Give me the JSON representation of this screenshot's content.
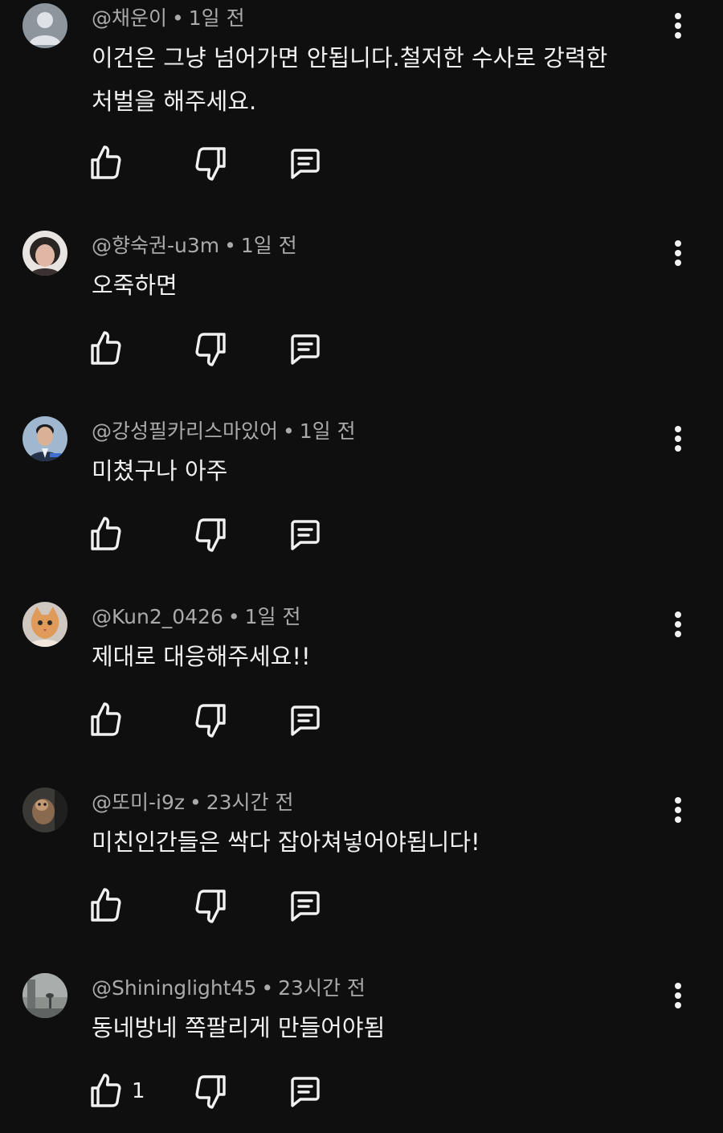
{
  "colors": {
    "background": "#0f0f0f",
    "primary_text": "#f1f1f1",
    "secondary_text": "#aaaaaa"
  },
  "icons": {
    "like": "thumb-up-outline-icon",
    "dislike": "thumb-down-outline-icon",
    "reply": "comment-reply-icon",
    "menu": "more-vertical-icon"
  },
  "separator": "•",
  "comments": [
    {
      "author": "@채운이",
      "time": "1일 전",
      "lines": [
        "이건은 그냥 넘어가면 안됩니다.철저한 수사로 강력한",
        "처벌을 해주세요."
      ],
      "likes": ""
    },
    {
      "author": "@향숙권-u3m",
      "time": "1일 전",
      "lines": [
        "오죽하면"
      ],
      "likes": ""
    },
    {
      "author": "@강성필카리스마있어",
      "time": "1일 전",
      "lines": [
        "미쳤구나 아주"
      ],
      "likes": ""
    },
    {
      "author": "@Kun2_0426",
      "time": "1일 전",
      "lines": [
        "제대로 대응해주세요!!"
      ],
      "likes": ""
    },
    {
      "author": "@또미-i9z",
      "time": "23시간 전",
      "lines": [
        "미친인간들은 싹다 잡아쳐넣어야됩니다!"
      ],
      "likes": ""
    },
    {
      "author": "@Shininglight45",
      "time": "23시간 전",
      "lines": [
        "동네방네 쪽팔리게 만들어야됨"
      ],
      "likes": "1"
    }
  ]
}
